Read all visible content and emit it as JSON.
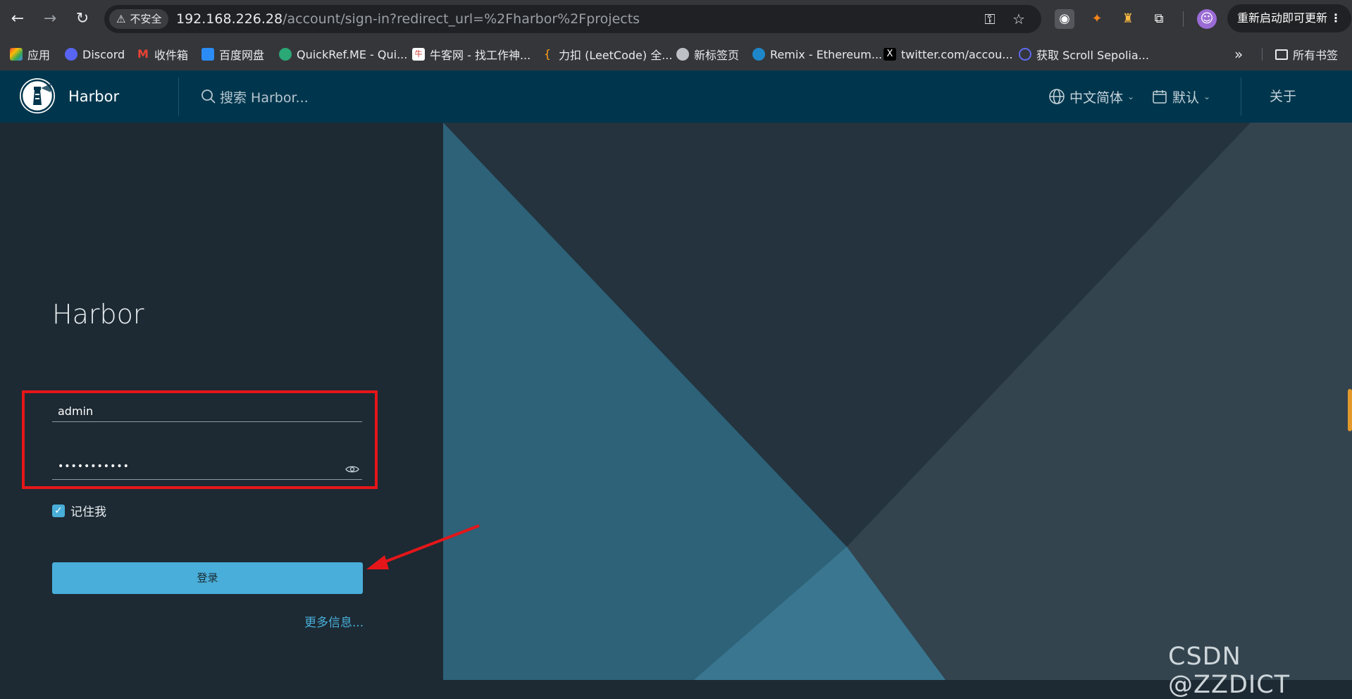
{
  "browser": {
    "security": "不安全",
    "url_host": "192.168.226.28",
    "url_path": "/account/sign-in?redirect_url=%2Fharbor%2Fprojects",
    "update_label": "重新启动即可更新"
  },
  "bookmarks": [
    {
      "label": "应用",
      "icon": "apps-grid-icon"
    },
    {
      "label": "Discord",
      "icon": "discord-icon"
    },
    {
      "label": "收件箱",
      "icon": "gmail-icon"
    },
    {
      "label": "百度网盘",
      "icon": "baidu-netdisk-icon"
    },
    {
      "label": "QuickRef.ME - Qui...",
      "icon": "quickref-icon"
    },
    {
      "label": "牛客网 - 找工作神...",
      "icon": "nowcoder-icon"
    },
    {
      "label": "力扣 (LeetCode) 全...",
      "icon": "leetcode-icon"
    },
    {
      "label": "新标签页",
      "icon": "globe-icon"
    },
    {
      "label": "Remix - Ethereum...",
      "icon": "remix-icon"
    },
    {
      "label": "twitter.com/accou...",
      "icon": "x-icon"
    },
    {
      "label": "获取 Scroll Sepolia...",
      "icon": "scroll-icon"
    }
  ],
  "bookmarks_all": "所有书签",
  "header": {
    "title": "Harbor",
    "search_placeholder": "搜索 Harbor...",
    "language": "中文简体",
    "scheme": "默认",
    "about": "关于"
  },
  "login": {
    "title": "Harbor",
    "username": "admin",
    "password_mask": "•••••••••••",
    "remember_me": "记住我",
    "remember_checked": true,
    "submit": "登录",
    "more_info": "更多信息..."
  },
  "watermark": "CSDN @ZZDICT",
  "colors": {
    "header_bg": "#00364d",
    "panel_bg": "#1d2a33",
    "accent": "#49aed9",
    "annotation_red": "#e5161a"
  }
}
